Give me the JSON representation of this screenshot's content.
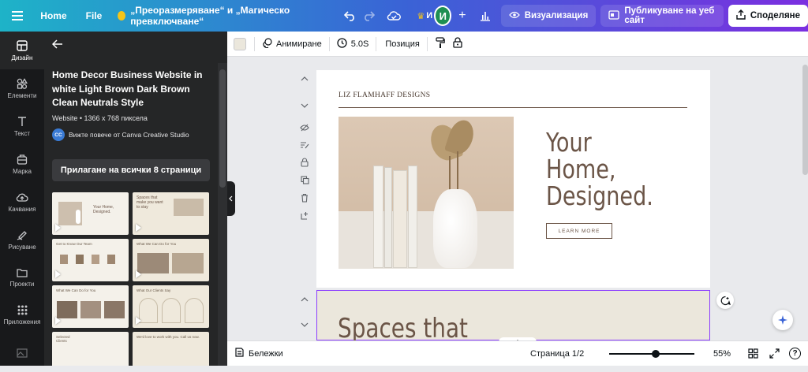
{
  "topbar": {
    "home": "Home",
    "file": "File",
    "doc_title": "„Преоразмеряване“ и „Магическо превключване“",
    "avatar_letter": "И",
    "avatar_partial": "И",
    "visualize": "Визуализация",
    "publish": "Публикуване на уеб сайт",
    "share": "Споделяне"
  },
  "rail": {
    "items": [
      {
        "label": "Дизайн"
      },
      {
        "label": "Елементи"
      },
      {
        "label": "Текст"
      },
      {
        "label": "Марка"
      },
      {
        "label": "Качвания"
      },
      {
        "label": "Рисуване"
      },
      {
        "label": "Проекти"
      },
      {
        "label": "Приложения"
      }
    ]
  },
  "panel": {
    "title": "Home Decor Business Website in white Light Brown Dark Brown Clean Neutrals Style",
    "meta": "Website • 1366 x 768 пиксела",
    "creator_badge": "CC",
    "creator": "Вижте повече от Canva Creative Studio",
    "apply_all": "Прилагане на всички 8 страници",
    "thumbs": [
      {
        "text": "Your Home, Designed."
      },
      {
        "text": "Spaces that make you want to stay"
      },
      {
        "text": "Get to Know Our Team"
      },
      {
        "text": "What We Can Do for You"
      },
      {
        "text": "What We Can Do for You"
      },
      {
        "text": "What Our Clients Say"
      },
      {
        "text": "Selected Clients"
      },
      {
        "text": "We'd love to work with you. Call us now."
      }
    ]
  },
  "subbar": {
    "animate": "Анимиране",
    "duration": "5.0S",
    "position": "Позиция",
    "swatch_color": "#ebe7dc"
  },
  "page1": {
    "brand": "LIZ FLAMHAFF DESIGNS",
    "headline_1": "Your",
    "headline_2": "Home,",
    "headline_3": "Designed.",
    "cta": "LEARN MORE"
  },
  "page2": {
    "headline": "Spaces that"
  },
  "bottombar": {
    "notes": "Бележки",
    "page": "Страница 1/2",
    "zoom": "55%",
    "zoom_level": 0.55
  },
  "colors": {
    "accent": "#8b3dff",
    "brown": "#6b5547",
    "panel": "#252627",
    "rail": "#18191b"
  }
}
